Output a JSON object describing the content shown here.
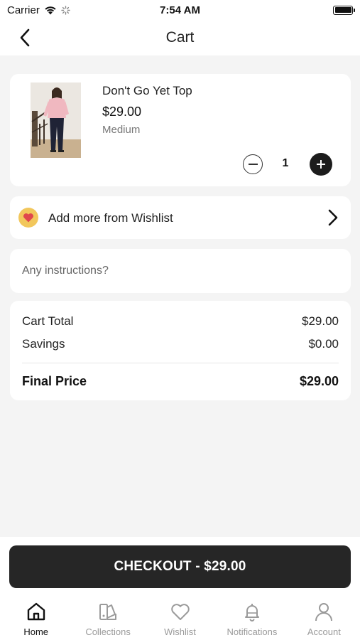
{
  "status_bar": {
    "carrier": "Carrier",
    "time": "7:54 AM"
  },
  "header": {
    "title": "Cart"
  },
  "cart_item": {
    "name": "Don't Go Yet Top",
    "price": "$29.00",
    "size": "Medium",
    "quantity": "1"
  },
  "wishlist": {
    "label": "Add more from Wishlist"
  },
  "instructions": {
    "placeholder": "Any instructions?"
  },
  "summary": {
    "cart_total_label": "Cart Total",
    "cart_total_value": "$29.00",
    "savings_label": "Savings",
    "savings_value": "$0.00",
    "final_label": "Final Price",
    "final_value": "$29.00"
  },
  "checkout": {
    "label": "CHECKOUT - $29.00"
  },
  "tabs": [
    {
      "label": "Home",
      "icon": "home-icon",
      "active": true
    },
    {
      "label": "Collections",
      "icon": "collections-icon",
      "active": false
    },
    {
      "label": "Wishlist",
      "icon": "heart-icon",
      "active": false
    },
    {
      "label": "Notifications",
      "icon": "bell-icon",
      "active": false
    },
    {
      "label": "Account",
      "icon": "person-icon",
      "active": false
    }
  ],
  "colors": {
    "background": "#f4f4f4",
    "checkout_button": "#262626",
    "wishlist_badge": "#f2c75c",
    "heart": "#e0474c",
    "inactive_tab": "#9a9a9a"
  }
}
